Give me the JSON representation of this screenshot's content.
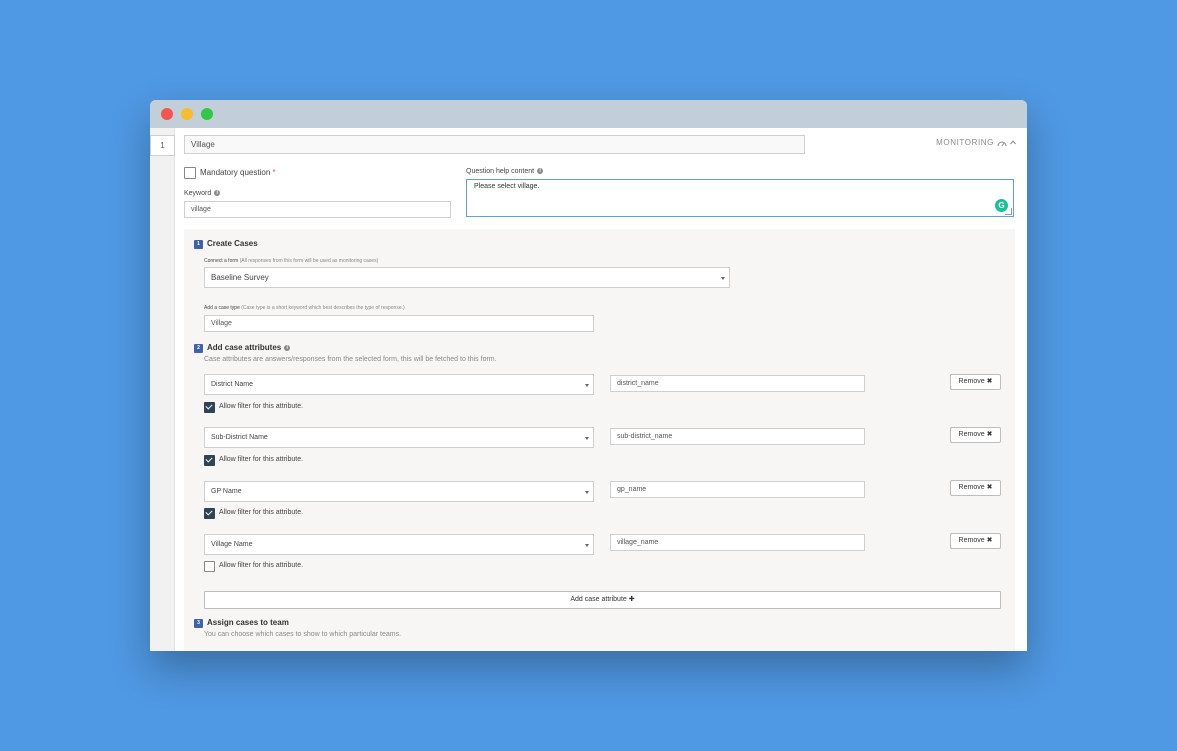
{
  "question": {
    "number": "1",
    "title": "Village",
    "monitoring_label": "MONITORING",
    "mandatory_label": "Mandatory question",
    "mandatory_star": "*",
    "keyword_label": "Keyword",
    "keyword_value": "village",
    "help_label": "Question help content",
    "help_value": "Please select village."
  },
  "step1": {
    "number": "1",
    "heading": "Create Cases",
    "connect_label": "Connect a form",
    "connect_note": "(All responses from this form will be used as monitoring cases)",
    "connect_value": "Baseline Survey",
    "case_type_label": "Add a case type",
    "case_type_note": "(Case type is a short keyword which best describes the type of response.)",
    "case_type_value": "Village"
  },
  "step2": {
    "number": "2",
    "heading": "Add case attributes",
    "desc": "Case attributes are answers/responses from the selected form, this will be fetched to this form.",
    "filter_label": "Allow filter for this attribute.",
    "remove_label": "Remove",
    "attributes": [
      {
        "field": "District Name",
        "key": "district_name",
        "filter": true
      },
      {
        "field": "Sub-District Name",
        "key": "sub-district_name",
        "filter": true
      },
      {
        "field": "GP Name",
        "key": "gp_name",
        "filter": true
      },
      {
        "field": "Village Name",
        "key": "village_name",
        "filter": false
      }
    ],
    "add_button": "Add case attribute"
  },
  "step3": {
    "number": "3",
    "heading": "Assign cases to team",
    "desc": "You can choose which cases to show to which particular teams."
  },
  "colors": {
    "background": "#4f98e3",
    "titlebar": "#c2cfd9",
    "step_badge": "#3d64a8",
    "checkbox_on": "#2f4357",
    "grammarly": "#15c39a"
  }
}
